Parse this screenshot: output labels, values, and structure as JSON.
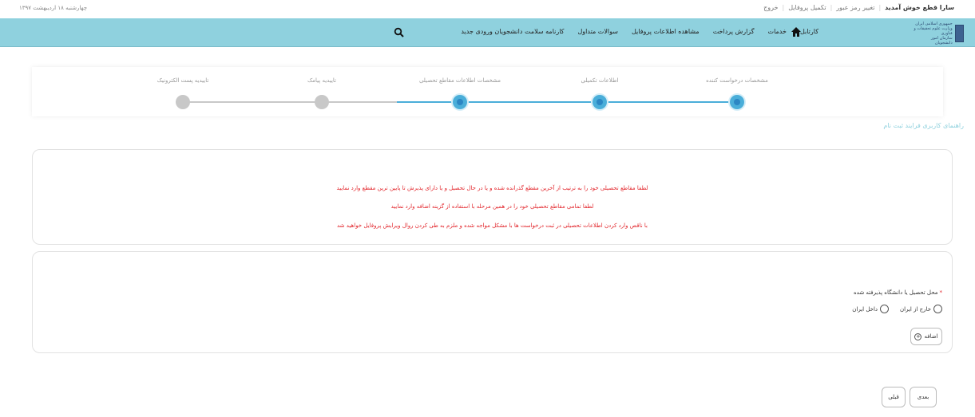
{
  "topbar": {
    "date": "چهارشنبه ۱۸ اردیبهشت ۱۳۹۷",
    "greeting": "سارا قطع خوش آمدید",
    "links": [
      "تغییر رمز عبور",
      "تکمیل پروفایل",
      "خروج"
    ]
  },
  "nav": {
    "logo_text": [
      "جمهوری اسلامی ایران",
      "وزارت علوم تحقیقات و فناوری",
      "سازمان امور دانشجویان"
    ],
    "home_icon": "home-icon",
    "search_icon": "search-icon",
    "menu": [
      "کارتابل",
      "خدمات",
      "گزارش پرداخت",
      "مشاهده اطلاعات پروفایل",
      "سوالات متداول",
      "کارنامه سلامت دانشجویان ورودی جدید"
    ]
  },
  "wizard": {
    "steps": [
      {
        "label": "مشخصات درخواست کننده",
        "state": "active"
      },
      {
        "label": "اطلاعات تکمیلی",
        "state": "active"
      },
      {
        "label": "مشخصات اطلاعات مقاطع تحصیلی",
        "state": "active"
      },
      {
        "label": "تاییدیه پیامک",
        "state": "inactive"
      },
      {
        "label": "تاییدیه پست الکترونیک",
        "state": "inactive"
      }
    ],
    "active_color": "#4aaed9",
    "inactive_color": "#c8c8c8"
  },
  "guide_link": "راهنمای کاربری فرایند ثبت نام",
  "alert": {
    "lines": [
      "لطفا مقاطع تحصیلی خود را به ترتیب از آخرین مقطع گذرانده شده و یا در حال تحصیل و یا دارای پذیرش تا پایین ترین مقطع وارد نمایید",
      "لطفا تمامی مقاطع تحصیلی خود را در همین مرحله با استفاده از گزینه اضافه وارد نمایید",
      "با ناقص وارد کردن اطلاعات تحصیلی در ثبت درخواست ها با مشکل مواجه شده و ملزم به طی کردن روال ویرایش پروفایل خواهید شد"
    ],
    "color": "#e2252b"
  },
  "form": {
    "required_mark": "*",
    "field_label": "محل تحصیل یا دانشگاه پذیرفته شده",
    "options": [
      "خارج از ایران",
      "داخل ایران"
    ],
    "add_label": "اضافه",
    "add_icon": "plus-circle-icon"
  },
  "footer": {
    "next_label": "بعدی",
    "prev_label": "قبلی"
  }
}
